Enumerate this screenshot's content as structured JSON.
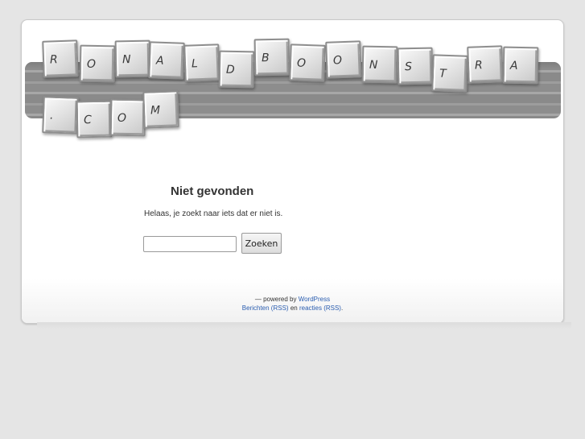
{
  "header": {
    "keys": [
      {
        "letter": "R"
      },
      {
        "letter": "O"
      },
      {
        "letter": "N"
      },
      {
        "letter": "A"
      },
      {
        "letter": "L"
      },
      {
        "letter": "D"
      },
      {
        "letter": "B"
      },
      {
        "letter": "O"
      },
      {
        "letter": "O"
      },
      {
        "letter": "N"
      },
      {
        "letter": "S"
      },
      {
        "letter": "T"
      },
      {
        "letter": "R"
      },
      {
        "letter": "A"
      },
      {
        "letter": "."
      },
      {
        "letter": "C"
      },
      {
        "letter": "O"
      },
      {
        "letter": "M"
      }
    ]
  },
  "main": {
    "title": "Niet gevonden",
    "message": "Helaas, je zoekt naar iets dat er niet is.",
    "search_value": "",
    "search_button": "Zoeken"
  },
  "footer": {
    "powered_prefix": "— powered by",
    "wordpress_link": "WordPress",
    "posts_rss_link": "Berichten (RSS)",
    "and_text": "en",
    "comments_rss_link": "reacties (RSS)",
    "period": "."
  },
  "colors": {
    "background": "#e5e5e5",
    "page": "#ffffff",
    "link": "#2a5db0",
    "band": "#8d8d8d"
  }
}
